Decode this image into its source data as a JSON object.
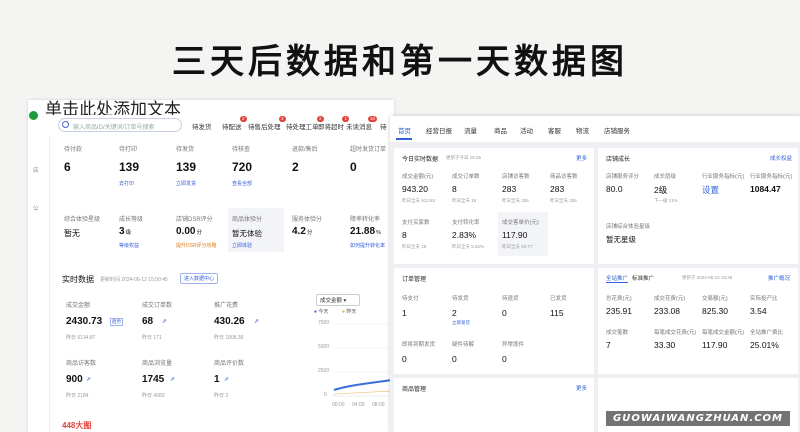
{
  "page_title": "三天后数据和第一天数据图",
  "overlay_caption": "单击此处添加文本",
  "watermark": "GUOWAIWANGZHUAN.COM",
  "left": {
    "search_placeholder": "输入商品ID/关键词/订单号搜索",
    "tabs": [
      {
        "label": "待发货",
        "badge": ""
      },
      {
        "label": "待配送",
        "badge": "2"
      },
      {
        "label": "待售后处理",
        "badge": "3"
      },
      {
        "label": "待处理工单",
        "badge": "2"
      },
      {
        "label": "即将超时",
        "badge": "1"
      },
      {
        "label": "未读消息",
        "badge": "10"
      },
      {
        "label": "待",
        "badge": ""
      }
    ],
    "sidebar": [
      "店",
      "公"
    ],
    "top_stats": [
      {
        "label": "待付款",
        "value": "6",
        "link": ""
      },
      {
        "label": "待打印",
        "value": "139",
        "link": "去打印"
      },
      {
        "label": "待发货",
        "value": "139",
        "link": "立即发货"
      },
      {
        "label": "待核查",
        "value": "720",
        "link": "查看全部"
      },
      {
        "label": "退款/售后",
        "value": "2",
        "link": ""
      },
      {
        "label": "超时发货订单",
        "value": "0",
        "link": ""
      }
    ],
    "mid_stats": [
      {
        "label": "综合体验星级",
        "value": "暂无",
        "unit": "",
        "link": ""
      },
      {
        "label": "成长等级",
        "value": "3",
        "unit": "级",
        "link": "等级权益"
      },
      {
        "label": "店铺DSR评分",
        "value": "0.00",
        "unit": "分",
        "link": "提升DSR评分攻略"
      },
      {
        "label": "商品体验分",
        "value": "暂无体验",
        "unit": "",
        "link": "立即体验"
      },
      {
        "label": "服务体验分",
        "value": "4.2",
        "unit": "分",
        "link": ""
      },
      {
        "label": "障率转化率",
        "value": "21.88",
        "unit": "%",
        "link": "如何提升转化率"
      }
    ],
    "realtime": {
      "title": "实时数据",
      "updated": "更新时间 2024-06-12 15:00:45",
      "button": "进入数据中心",
      "dropdown": "成交金额",
      "legend_today": "今天",
      "legend_yesterday": "昨天",
      "y_ticks": [
        "7500",
        "5000",
        "2500",
        "0"
      ],
      "x_ticks": [
        "00:00",
        "04:00",
        "08:00"
      ],
      "metrics": [
        {
          "label": "成交金额",
          "value": "2430.73",
          "badge": "趋势",
          "sub": "昨日 6134.87"
        },
        {
          "label": "成交订单数",
          "value": "68",
          "badge": "",
          "sub": "昨日 171"
        },
        {
          "label": "推广花费",
          "value": "430.26",
          "badge": "",
          "sub": "昨日 1808.39"
        },
        {
          "label": "商品访客数",
          "value": "900",
          "badge": "",
          "sub": "昨日 2184"
        },
        {
          "label": "商品浏览量",
          "value": "1745",
          "badge": "",
          "sub": "昨日 4083"
        },
        {
          "label": "商品评价数",
          "value": "1",
          "badge": "",
          "sub": "昨日 2"
        }
      ]
    },
    "bottom_partial": "448大图"
  },
  "right": {
    "nav": [
      "首页",
      "经营日报",
      "流量",
      "商品",
      "活动",
      "客服",
      "物流",
      "店铺服务"
    ],
    "today": {
      "title": "今日实时数据",
      "updated": "更新于今日 15:46",
      "more": "更多",
      "cells": [
        {
          "label": "成交金额(元)",
          "value": "943.20",
          "sub": "昨日全天 913.83"
        },
        {
          "label": "成交订单数",
          "value": "8",
          "sub": "昨日全天 18"
        },
        {
          "label": "店铺访客数",
          "value": "283",
          "sub": "昨日全天 326"
        },
        {
          "label": "商品访客数",
          "value": "283",
          "sub": "昨日全天 326"
        },
        {
          "label": "支付买家数",
          "value": "8",
          "sub": "昨日全天 18"
        },
        {
          "label": "支付转化率",
          "value": "2.83%",
          "sub": "昨日全天 5.52%"
        },
        {
          "label": "成交客单价(元)",
          "value": "117.90",
          "sub": "昨日全天 50.77"
        }
      ]
    },
    "store_growth": {
      "title": "店铺成长",
      "more": "成长权益",
      "cells": [
        {
          "label": "店铺服务评分",
          "value": "80.0",
          "sub": ""
        },
        {
          "label": "成长层级",
          "value": "2级",
          "sub": "下一级 21%"
        },
        {
          "label": "行业服务指标(元)",
          "value": "设置",
          "sub": ""
        },
        {
          "label": "行业服务指标(元)",
          "value": "1084.47",
          "sub": ""
        }
      ],
      "level_label": "店铺综合体验星级",
      "level_value": "暂无星级"
    },
    "orders": {
      "title": "订单管理",
      "more": "更多",
      "cells": [
        {
          "label": "待支付",
          "value": "1",
          "sub": ""
        },
        {
          "label": "待发货",
          "value": "2",
          "sub": "立即发货"
        },
        {
          "label": "待退货",
          "value": "0",
          "sub": ""
        },
        {
          "label": "已发货",
          "value": "115",
          "sub": ""
        },
        {
          "label": "即将到期发货",
          "value": "0",
          "sub": ""
        },
        {
          "label": "疑件待解",
          "value": "0",
          "sub": ""
        },
        {
          "label": "异常揽件",
          "value": "0",
          "sub": ""
        }
      ]
    },
    "ads": {
      "tabs": [
        "全站推广",
        "标准推广"
      ],
      "updated": "更新于 2024-06-12 15:46",
      "more": "推广概况",
      "cells": [
        {
          "label": "总花费(元)",
          "value": "235.91"
        },
        {
          "label": "成交花费(元)",
          "value": "233.08"
        },
        {
          "label": "交易额(元)",
          "value": "825.30"
        },
        {
          "label": "实际投产比",
          "value": "3.54"
        },
        {
          "label": "成交笔数",
          "value": "7"
        },
        {
          "label": "每笔成交花费(元)",
          "value": "33.30"
        },
        {
          "label": "每笔成交金额(元)",
          "value": "117.90"
        },
        {
          "label": "全站推广费比",
          "value": "25.01%"
        }
      ]
    },
    "goods": {
      "title": "商品管理",
      "more": "更多"
    }
  }
}
